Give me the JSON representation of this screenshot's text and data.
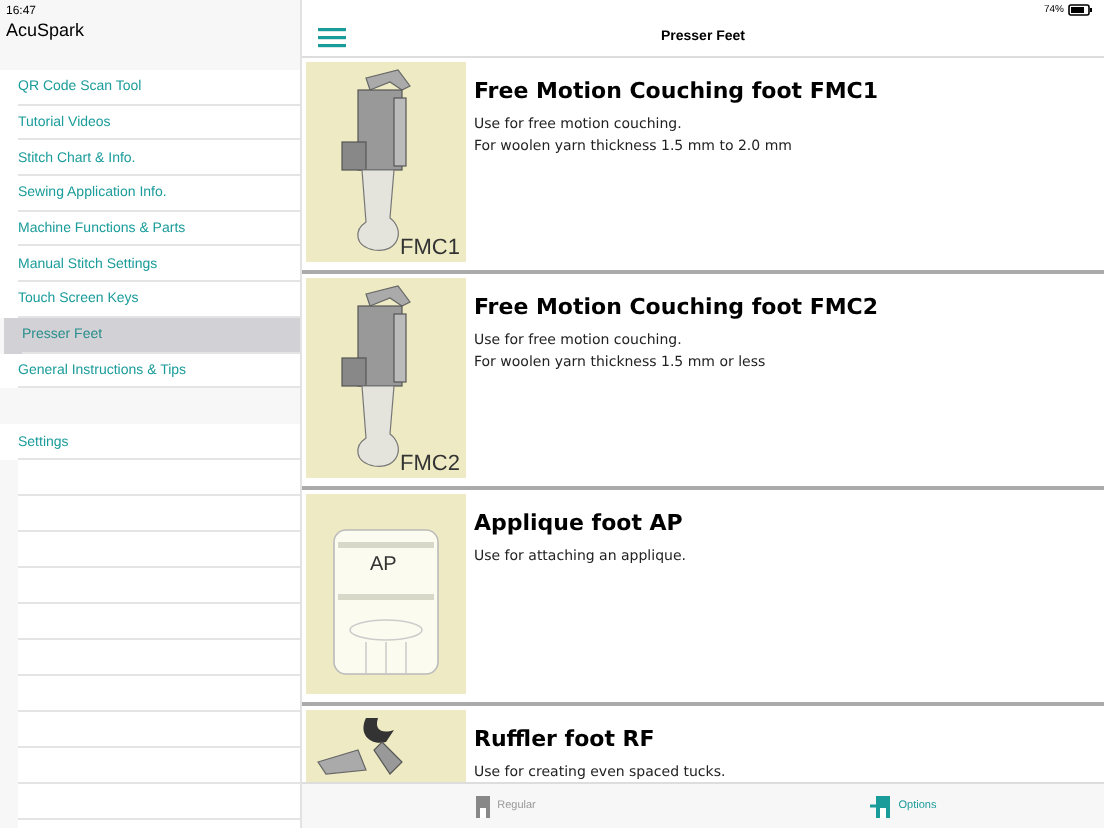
{
  "status_bar": {
    "time": "16:47",
    "battery": "74%"
  },
  "sidebar": {
    "title": "AcuSpark",
    "items": [
      {
        "label": "QR Code Scan Tool",
        "selected": false
      },
      {
        "label": "Tutorial Videos",
        "selected": false
      },
      {
        "label": "Stitch Chart & Info.",
        "selected": false
      },
      {
        "label": "Sewing Application Info.",
        "selected": false
      },
      {
        "label": "Machine Functions & Parts",
        "selected": false
      },
      {
        "label": "Manual Stitch Settings",
        "selected": false
      },
      {
        "label": "Touch Screen Keys",
        "selected": false
      },
      {
        "label": "Presser Feet",
        "selected": true
      },
      {
        "label": "General Instructions & Tips",
        "selected": false
      }
    ],
    "settings": "Settings"
  },
  "nav": {
    "title": "Presser Feet"
  },
  "feet": [
    {
      "kind": "vertical",
      "image_label": "FMC1",
      "title": "Free Motion Couching foot FMC1",
      "lines": [
        "Use for free motion couching.",
        "For woolen yarn thickness 1.5 mm to 2.0 mm"
      ]
    },
    {
      "kind": "vertical",
      "image_label": "FMC2",
      "title": "Free Motion Couching foot FMC2",
      "lines": [
        "Use for free motion couching.",
        "For woolen yarn thickness 1.5 mm or less"
      ]
    },
    {
      "kind": "flat",
      "image_label": "AP",
      "title": "Applique foot AP",
      "lines": [
        "Use for attaching an applique."
      ]
    },
    {
      "kind": "ruffler",
      "title": "Ruffler foot RF",
      "lines": [
        "Use for creating even spaced tucks."
      ]
    }
  ],
  "tabs": [
    {
      "label": "Regular",
      "selected": false
    },
    {
      "label": "Options",
      "selected": true
    }
  ]
}
